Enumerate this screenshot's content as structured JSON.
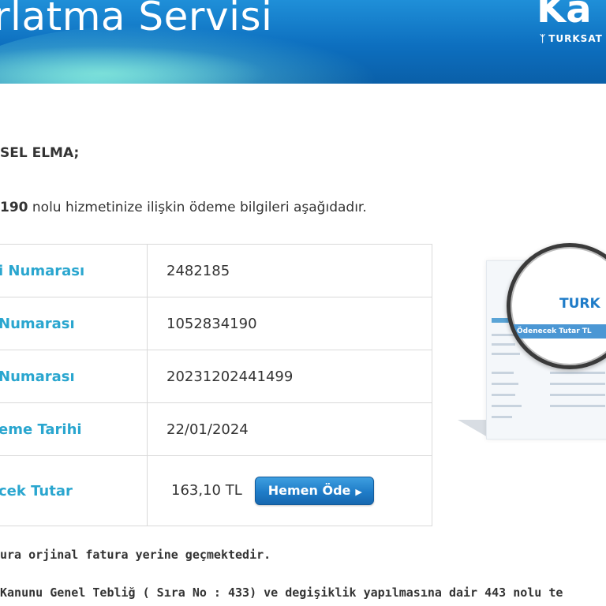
{
  "banner": {
    "title": "rlatma Servisi",
    "logo": "Ka",
    "logo_sub": "TURKSAT"
  },
  "greeting": "SEL ELMA;",
  "intro": {
    "number_fragment": "190",
    "text": " nolu hizmetinize ilişkin ödeme bilgileri aşağıdadır."
  },
  "table": {
    "rows": [
      {
        "label": "i Numarası",
        "value": "2482185"
      },
      {
        "label": "Numarası",
        "value": "1052834190"
      },
      {
        "label": "Numarası",
        "value": "20231202441499"
      },
      {
        "label": "eme Tarihi",
        "value": "22/01/2024"
      },
      {
        "label": "cek Tutar",
        "value": "163,10 TL"
      }
    ],
    "pay_button": "Hemen Öde"
  },
  "notes": {
    "line1": "ura orjinal fatura yerine geçmektedir.",
    "line2": "Kanunu Genel Tebliğ ( Sıra No : 433) ve degişiklik yapılmasına dair 443 nolu te"
  },
  "illustration": {
    "logo": "TURK",
    "bar": "Ödenecek Tutar   TL"
  },
  "colors": {
    "banner": "#0d6fbf",
    "label": "#2aa6cf",
    "button": "#1f7cc8"
  }
}
